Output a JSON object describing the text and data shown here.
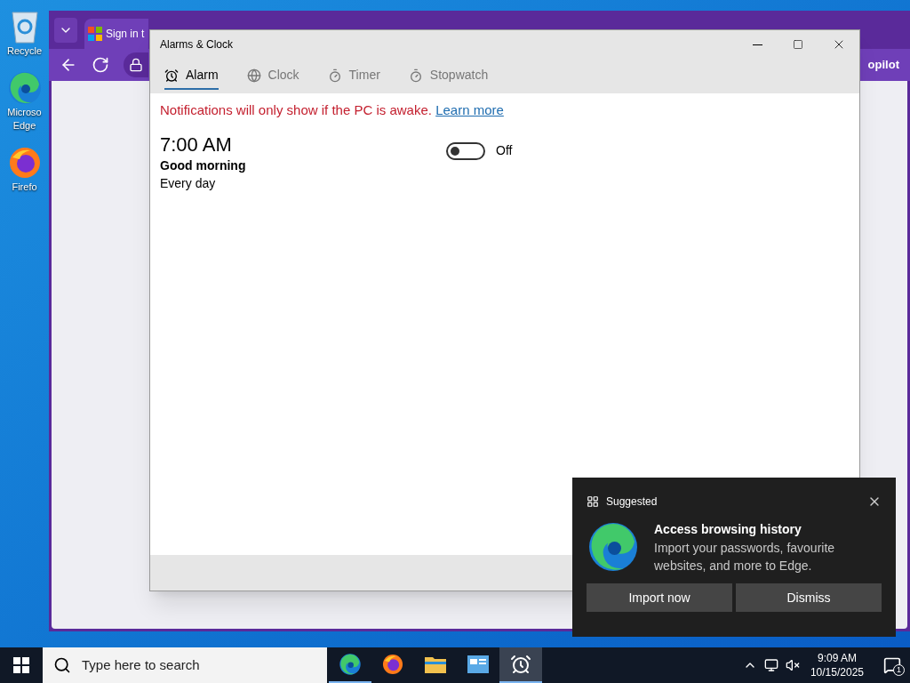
{
  "desktop_icons": [
    {
      "kind": "recycle",
      "label": "Recycle"
    },
    {
      "kind": "edge",
      "label": "Microso\nEdge"
    },
    {
      "kind": "firefox",
      "label": "Firefo"
    }
  ],
  "browser": {
    "tab_title": "Sign in t",
    "copilot_label": "opilot"
  },
  "window": {
    "title": "Alarms & Clock"
  },
  "tabs": [
    {
      "kind": "alarm",
      "label": "Alarm",
      "selected": true
    },
    {
      "kind": "clock",
      "label": "Clock",
      "selected": false
    },
    {
      "kind": "timer",
      "label": "Timer",
      "selected": false
    },
    {
      "kind": "stopwatch",
      "label": "Stopwatch",
      "selected": false
    }
  ],
  "notice": {
    "text": "Notifications will only show if the PC is awake.",
    "link": "Learn more"
  },
  "alarms": [
    {
      "time": "7:00 AM",
      "name": "Good morning",
      "repeat": "Every day",
      "on": false,
      "state_label": "Off"
    }
  ],
  "toast": {
    "header": "Suggested",
    "title": "Access browsing history",
    "body": "Import your passwords, favourite websites, and more to Edge.",
    "buttons": [
      "Import now",
      "Dismiss"
    ]
  },
  "taskbar": {
    "search_placeholder": "Type here to search",
    "apps": [
      {
        "kind": "edge",
        "running": true,
        "selected": false
      },
      {
        "kind": "firefox",
        "running": false,
        "selected": false
      },
      {
        "kind": "folder",
        "running": false,
        "selected": false
      },
      {
        "kind": "panel",
        "running": false,
        "selected": false
      },
      {
        "kind": "alarm",
        "running": true,
        "selected": true
      }
    ],
    "time": "9:09 AM",
    "date": "10/15/2025",
    "notification_count": "1"
  }
}
